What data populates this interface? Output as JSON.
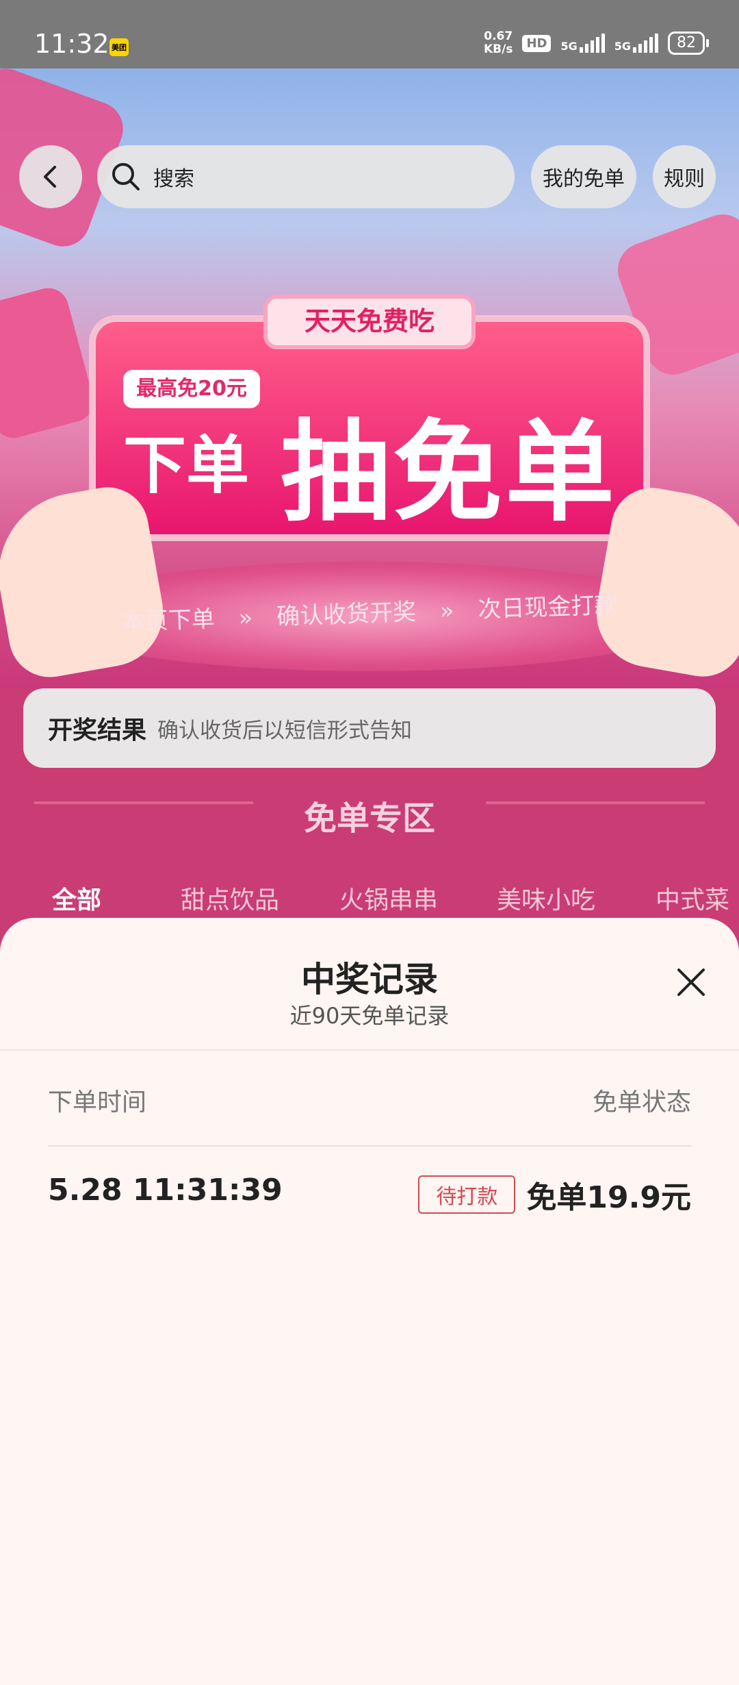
{
  "status_bar": {
    "time": "11:32",
    "app_badge": "美团",
    "net_speed_value": "0.67",
    "net_speed_unit": "KB/s",
    "hd": "HD",
    "signal1": "5G",
    "signal2": "5G",
    "battery": "82"
  },
  "header": {
    "search_placeholder": "搜索",
    "my_free_orders": "我的免单",
    "rules": "规则"
  },
  "banner": {
    "tag": "天天免费吃",
    "max_badge": "最高免20元",
    "headline_left": "下单",
    "headline_right": "抽免单",
    "steps": [
      "本页下单",
      "»",
      "确认收货开奖",
      "»",
      "次日现金打款"
    ]
  },
  "notice": {
    "label": "开奖结果",
    "text": "确认收货后以短信形式告知"
  },
  "zone": {
    "title": "免单专区",
    "tabs": [
      "全部",
      "甜点饮品",
      "火锅串串",
      "美味小吃",
      "中式菜"
    ]
  },
  "sheet": {
    "title": "中奖记录",
    "subtitle": "近90天免单记录",
    "col_time": "下单时间",
    "col_status": "免单状态",
    "records": [
      {
        "time": "5.28 11:31:39",
        "status": "待打款",
        "amount": "免单19.9元"
      }
    ]
  },
  "colors": {
    "accent_pink": "#ca3c74",
    "pending_red": "#d24a4f",
    "sheet_bg": "#fff5f3"
  },
  "icons": [
    "back-arrow-icon",
    "search-icon",
    "close-icon"
  ]
}
